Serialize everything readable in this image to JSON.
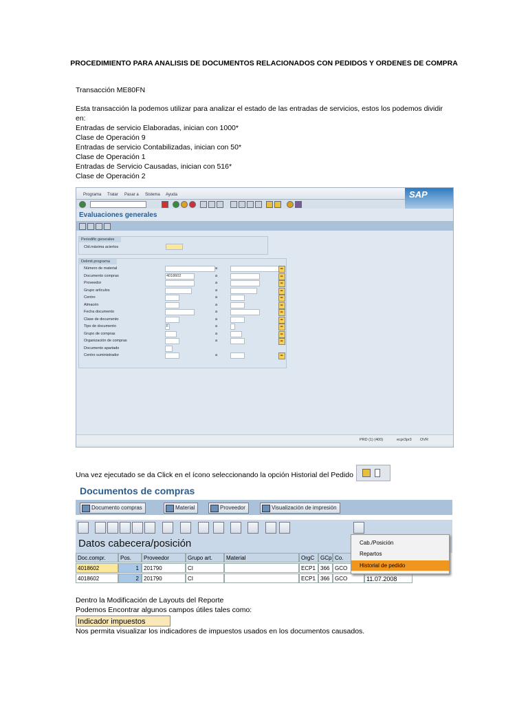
{
  "doc": {
    "title": "PROCEDIMIENTO PARA  ANALISIS DE DOCUMENTOS RELACIONADOS CON PEDIDOS Y ORDENES DE COMPRA",
    "transaction_label": "Transacción  ME80FN",
    "lines": [
      "Esta transacción la podemos utilizar para analizar el estado de las entradas de servicios, estos los podemos dividir",
      "en:",
      "Entradas de servicio Elaboradas, inician con 1000*",
      "Clase de Operación 9",
      "Entradas de servicio Contabilizadas, inician con 50*",
      "Clase de Operación 1",
      "Entradas de Servicio Causadas, inician con 516*",
      "Clase de Operación 2"
    ],
    "click_text": "Una vez ejecutado se da Click en el ícono seleccionando la opción Historial del Pedido",
    "layout_line1": "Dentro la Modificación de Layouts del Reporte",
    "layout_line2": "Podemos Encontrar algunos campos útiles tales como:",
    "field_box": "Indicador impuestos",
    "final_line": "Nos permita visualizar los indicadores de impuestos usados en los documentos causados."
  },
  "sap1": {
    "menu": [
      "Programa",
      "Tratar",
      "Pasar a",
      "Sistema",
      "Ayuda"
    ],
    "logo": "SAP",
    "screen_title": "Evaluaciones generales",
    "group1": {
      "title": "Periodific generales",
      "label": "Ctd.máxima aciertos"
    },
    "group2": {
      "title": "Delimit.programa",
      "to_label": "a",
      "rows": [
        {
          "label": "Número de material",
          "value": ""
        },
        {
          "label": "Documento compras",
          "value": "4018602"
        },
        {
          "label": "Proveedor",
          "value": ""
        },
        {
          "label": "Grupo artículos",
          "value": ""
        },
        {
          "label": "Centro",
          "value": ""
        },
        {
          "label": "Almacén",
          "value": ""
        },
        {
          "label": "Fecha documento",
          "value": ""
        },
        {
          "label": "Clase de documento",
          "value": ""
        },
        {
          "label": "Tipo de documento",
          "value": "F"
        },
        {
          "label": "Grupo de compras",
          "value": ""
        },
        {
          "label": "Organización de compras",
          "value": ""
        },
        {
          "label": "Documento apartado",
          "value": ""
        },
        {
          "label": "Centro suministrador",
          "value": ""
        }
      ]
    },
    "status": {
      "system": "PRD (1) (400)",
      "server": "ecpr3pr3",
      "mode": "OVR"
    }
  },
  "sap2": {
    "title": "Documentos de compras",
    "buttons": [
      "Documento compras",
      "Material",
      "Proveedor",
      "Visualización de impresión"
    ],
    "section": "Datos cabecera/posición",
    "columns": [
      "Doc.compr.",
      "Pos.",
      "Proveedor",
      "Grupo art.",
      "Material",
      "OrgC",
      "GCp",
      "Co."
    ],
    "rows": [
      [
        "4018602",
        "1",
        "201790",
        "CI",
        "",
        "ECP1",
        "366",
        "GCO"
      ],
      [
        "4018602",
        "2",
        "201790",
        "CI",
        "",
        "ECP1",
        "366",
        "GCO"
      ]
    ],
    "date_partial": "11.07.2008",
    "menu": [
      "Cab./Posición",
      "Repartos",
      "Historial de pedido"
    ]
  }
}
